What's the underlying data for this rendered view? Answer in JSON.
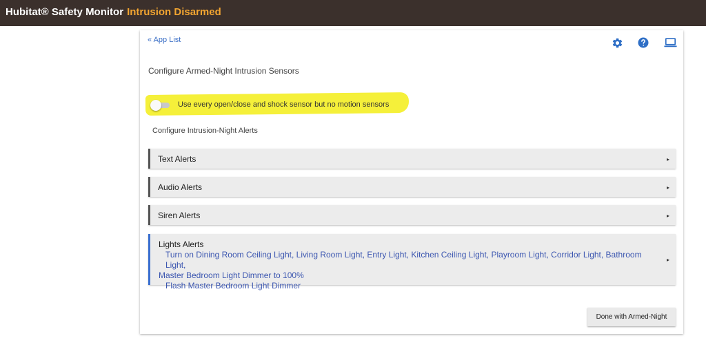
{
  "header": {
    "title": "Hubitat® Safety Monitor",
    "status": "Intrusion Disarmed"
  },
  "nav": {
    "back_label": "« App List"
  },
  "toolbar": {
    "icons": [
      "gear-icon",
      "help-icon",
      "laptop-icon"
    ]
  },
  "page": {
    "title": "Configure Armed-Night Intrusion Sensors",
    "toggle_label": "Use every open/close and shock sensor but no motion sensors",
    "toggle_on": false,
    "alerts_heading": "Configure Intrusion-Night Alerts"
  },
  "alerts": [
    {
      "label": "Text Alerts"
    },
    {
      "label": "Audio Alerts"
    },
    {
      "label": "Siren Alerts"
    },
    {
      "label": "Lights Alerts",
      "detail_line1": "Turn on Dining Room Ceiling Light, Living Room Light, Entry Light, Kitchen Ceiling Light, Playroom Light, Corridor Light, Bathroom Light,",
      "detail_line2": "Master Bedroom Light Dimmer to 100%",
      "detail_line3": "Flash  Master Bedroom Light Dimmer"
    }
  ],
  "expand_arrow": "▸",
  "footer": {
    "done_label": "Done with Armed-Night"
  },
  "colors": {
    "header_bg": "#3b302c",
    "status": "#f2a531",
    "link": "#3b6fc6",
    "highlight": "#f5f03a",
    "accent_blue": "#3a6fd0"
  }
}
